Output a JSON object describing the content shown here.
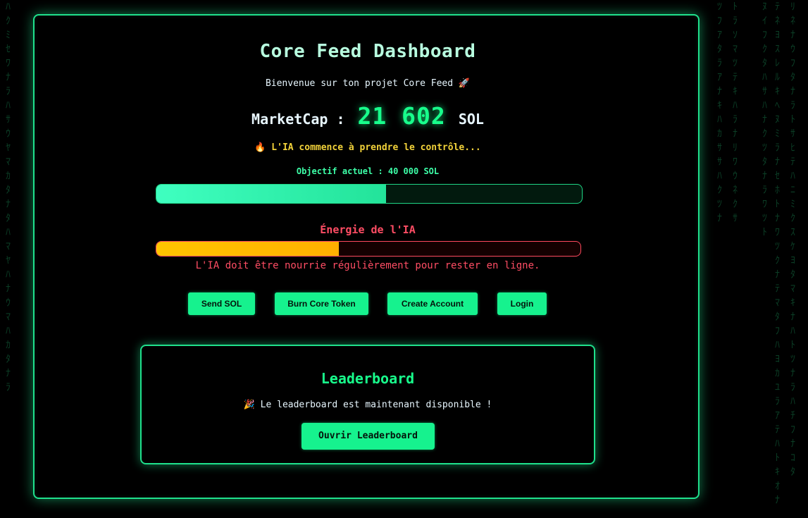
{
  "dashboard": {
    "title": "Core Feed Dashboard",
    "welcome": "Bienvenue sur ton projet Core Feed 🚀",
    "marketcap_label": "MarketCap :",
    "marketcap_value": "21 602",
    "marketcap_unit": "SOL",
    "status_message": "🔥 L'IA commence à prendre le contrôle...",
    "objective_label": "Objectif actuel : 40 000 SOL",
    "objective_progress": 0.54,
    "energy_label": "Énergie de l'IA",
    "energy_level": 0.43,
    "energy_note": "L'IA doit être nourrie régulièrement pour rester en ligne."
  },
  "actions": {
    "send_sol": "Send SOL",
    "burn_core": "Burn Core Token",
    "create_account": "Create Account",
    "login": "Login"
  },
  "leaderboard": {
    "title": "Leaderboard",
    "message": "🎉 Le leaderboard est maintenant disponible !",
    "open_button": "Ouvrir Leaderboard"
  },
  "colors": {
    "accent": "#16f28e",
    "danger": "#ff4d64",
    "energy": "#ffc400",
    "warning": "#f2d23a"
  }
}
